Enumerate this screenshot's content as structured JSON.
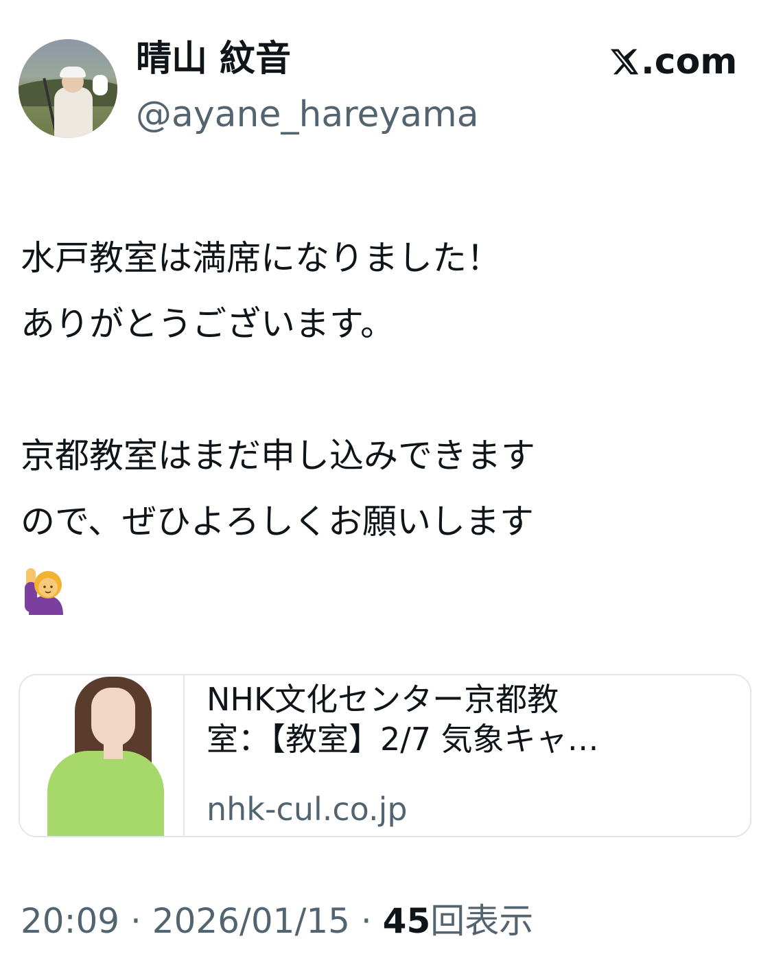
{
  "author": {
    "display_name": "晴山 紋音",
    "handle": "@ayane_hareyama"
  },
  "brand": {
    "label": ".com",
    "icon": "x-logo-icon"
  },
  "tweet": {
    "lines": [
      "水戸教室は満席になりました！",
      "ありがとうございます。",
      "",
      "京都教室はまだ申し込みできます",
      "ので、ぜひよろしくお願いします"
    ],
    "emoji": "person-raising-hand-emoji"
  },
  "card": {
    "title_lines": [
      "NHK文化センター京都教",
      "室：【教室】2/7 気象キャ…"
    ],
    "domain": "nhk-cul.co.jp"
  },
  "meta": {
    "time": "20:09",
    "separator": " · ",
    "date": "2026/01/15",
    "views_count": "45",
    "views_label": "回表示"
  },
  "colors": {
    "text_primary": "#0f1419",
    "text_secondary": "#536471",
    "card_border": "#e1e6ea"
  }
}
